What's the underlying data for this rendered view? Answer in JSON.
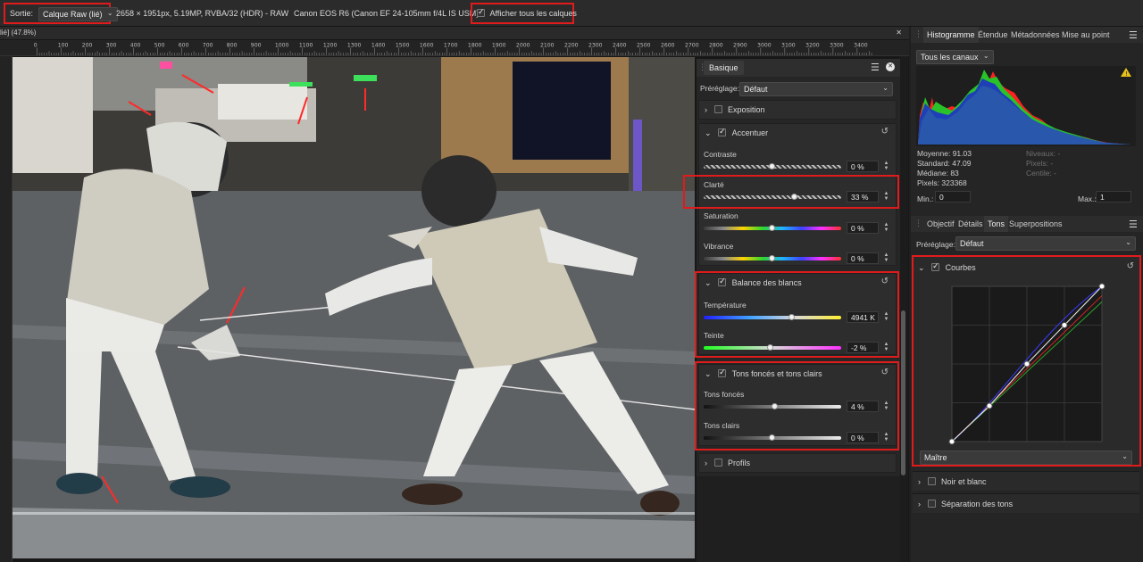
{
  "topbar": {
    "output_label": "Sortie:",
    "output_value": "Calque Raw (lié)",
    "image_info": "2658 × 1951px, 5.19MP, RVBA/32 (HDR) - RAW",
    "camera_info": "Canon EOS R6 (Canon EF 24-105mm f/4L IS USM)",
    "show_layers_label": "Afficher tous les calques"
  },
  "document": {
    "tab_title": "lié] (47.8%)",
    "ruler_ticks": [
      "0",
      "100",
      "200",
      "300",
      "400",
      "500",
      "600",
      "700",
      "800",
      "900",
      "1000",
      "1100",
      "1200",
      "1300",
      "1400",
      "1500",
      "1600",
      "1700",
      "1800",
      "1900",
      "2000",
      "2100",
      "2200",
      "2300",
      "2400",
      "2500",
      "2600",
      "2700",
      "2800",
      "2900",
      "3000",
      "3100",
      "3200",
      "3300",
      "3400"
    ]
  },
  "basique": {
    "tab": "Basique",
    "preset_label": "Préréglage:",
    "preset_value": "Défaut",
    "exposition": "Exposition",
    "accentuer": {
      "title": "Accentuer",
      "contraste_label": "Contraste",
      "contraste_value": "0 %",
      "clarte_label": "Clarté",
      "clarte_value": "33 %",
      "saturation_label": "Saturation",
      "saturation_value": "0 %",
      "vibrance_label": "Vibrance",
      "vibrance_value": "0 %"
    },
    "balance": {
      "title": "Balance des blancs",
      "temperature_label": "Température",
      "temperature_value": "4941 K",
      "teinte_label": "Teinte",
      "teinte_value": "-2 %"
    },
    "tons": {
      "title": "Tons foncés et tons clairs",
      "fonces_label": "Tons foncés",
      "fonces_value": "4 %",
      "clairs_label": "Tons clairs",
      "clairs_value": "0 %"
    },
    "profils": "Profils"
  },
  "slider_levels": {
    "contraste": 0.5,
    "clarte": 0.665,
    "saturation": 0.5,
    "vibrance": 0.5,
    "temperature": 0.64,
    "teinte": 0.49,
    "tons_fonces": 0.52,
    "tons_clairs": 0.5
  },
  "right_top": {
    "tabs": [
      "Histogramme",
      "Étendue",
      "Métadonnées",
      "Mise au point"
    ],
    "channel": "Tous les canaux",
    "stats_left": [
      "Moyenne: 91.03",
      "Standard: 47.09",
      "Médiane: 83",
      "Pixels: 323368"
    ],
    "stats_right": [
      "Niveaux: -",
      "Pixels: -",
      "Centile: -"
    ],
    "min_label": "Min.:",
    "min_value": "0",
    "max_label": "Max.:",
    "max_value": "1"
  },
  "right_bottom": {
    "tabs": [
      "Objectif",
      "Détails",
      "Tons",
      "Superpositions"
    ],
    "preset_label": "Préréglage:",
    "preset_value": "Défaut",
    "courbes": "Courbes",
    "curve_channel": "Maître",
    "noir_blanc": "Noir et blanc",
    "separation": "Séparation des tons"
  },
  "curve_points": [
    [
      0,
      0
    ],
    [
      0.25,
      0.23
    ],
    [
      0.5,
      0.5
    ],
    [
      0.75,
      0.75
    ],
    [
      1.0,
      1.0
    ]
  ],
  "colors": {
    "highlight": "#e01b1b",
    "panel": "#262626",
    "warning": "#e8c21a"
  }
}
